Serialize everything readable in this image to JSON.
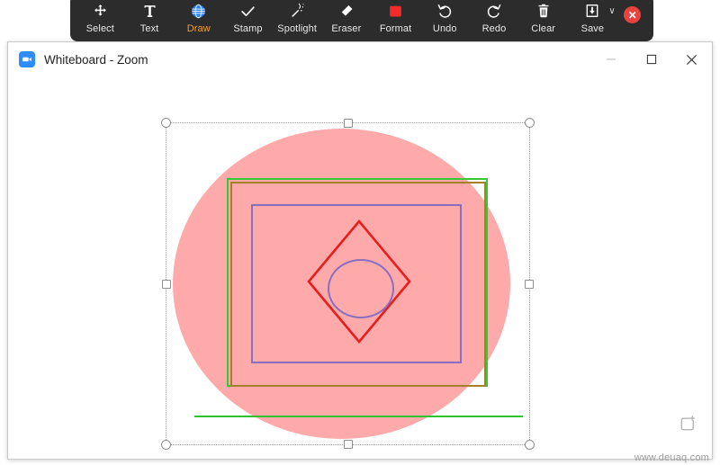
{
  "annotation_toolbar": {
    "background_color": "#2c2c2c",
    "active_color": "#f0a030",
    "tools": [
      {
        "id": "select",
        "label": "Select",
        "icon": "move-arrows-icon",
        "active": false,
        "has_dropdown": false
      },
      {
        "id": "text",
        "label": "Text",
        "icon": "text-t-icon",
        "active": false,
        "has_dropdown": false
      },
      {
        "id": "draw",
        "label": "Draw",
        "icon": "draw-globe-icon",
        "active": true,
        "has_dropdown": false
      },
      {
        "id": "stamp",
        "label": "Stamp",
        "icon": "checkmark-icon",
        "active": false,
        "has_dropdown": false
      },
      {
        "id": "spotlight",
        "label": "Spotlight",
        "icon": "magic-wand-icon",
        "active": false,
        "has_dropdown": false
      },
      {
        "id": "eraser",
        "label": "Eraser",
        "icon": "eraser-icon",
        "active": false,
        "has_dropdown": false
      },
      {
        "id": "format",
        "label": "Format",
        "icon": "red-square-icon",
        "active": false,
        "has_dropdown": false
      },
      {
        "id": "undo",
        "label": "Undo",
        "icon": "undo-arrow-icon",
        "active": false,
        "has_dropdown": false
      },
      {
        "id": "redo",
        "label": "Redo",
        "icon": "redo-arrow-icon",
        "active": false,
        "has_dropdown": false
      },
      {
        "id": "clear",
        "label": "Clear",
        "icon": "trash-can-icon",
        "active": false,
        "has_dropdown": false
      },
      {
        "id": "save",
        "label": "Save",
        "icon": "save-download-icon",
        "active": false,
        "has_dropdown": true
      }
    ],
    "close_button": {
      "icon": "close-x-icon",
      "glyph": "✕",
      "color": "#e8423f"
    },
    "dropdown_glyph": "∨"
  },
  "window": {
    "title": "Whiteboard - Zoom",
    "app_icon": "zoom-camera-icon",
    "controls": [
      {
        "id": "minimize",
        "icon": "minimize-icon",
        "glyph": "—"
      },
      {
        "id": "maximize",
        "icon": "maximize-icon",
        "glyph": "☐"
      },
      {
        "id": "close",
        "icon": "close-icon",
        "glyph": "✕"
      }
    ]
  },
  "canvas": {
    "background_color": "#ffffff",
    "selection": {
      "name": "selection-bounding-box",
      "border_style": "dotted",
      "border_color": "#9a9a9a",
      "handles": [
        "top-left",
        "top-center",
        "top-right",
        "middle-left",
        "middle-right",
        "bottom-left",
        "bottom-center",
        "bottom-right"
      ]
    },
    "shapes": [
      {
        "id": "pink-circle",
        "type": "ellipse",
        "fill": "#ffaaaa",
        "stroke": "none"
      },
      {
        "id": "green-rect",
        "type": "rectangle",
        "fill": "none",
        "stroke": "#35c935"
      },
      {
        "id": "olive-rect",
        "type": "rectangle",
        "fill": "none",
        "stroke": "#a5822a"
      },
      {
        "id": "purple-rect",
        "type": "rectangle",
        "fill": "none",
        "stroke": "#8a6fc0"
      },
      {
        "id": "red-diamond",
        "type": "diamond",
        "fill": "none",
        "stroke": "#e81e1e"
      },
      {
        "id": "purple-circle",
        "type": "ellipse",
        "fill": "none",
        "stroke": "#8a6fc0"
      },
      {
        "id": "green-line",
        "type": "line",
        "fill": "none",
        "stroke": "#2fc42f"
      }
    ],
    "add_page": {
      "icon": "add-page-icon",
      "label": ""
    }
  },
  "watermark": {
    "text": "www.deuaq.com"
  }
}
